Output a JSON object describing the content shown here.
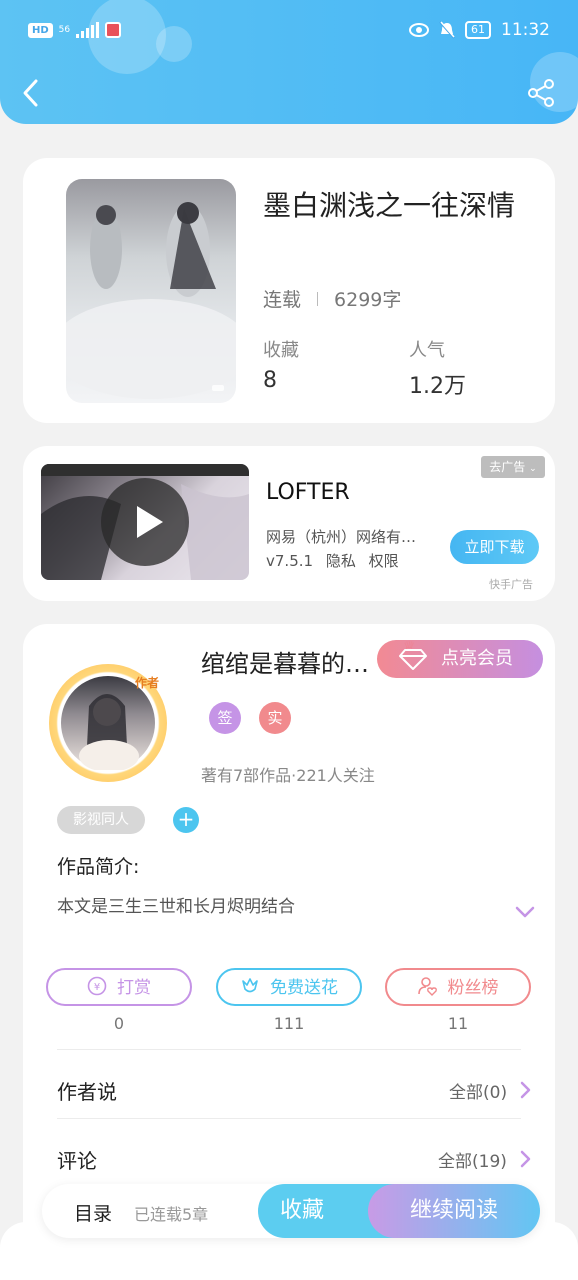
{
  "status": {
    "network": "HD",
    "signal": "56",
    "battery": "61",
    "time": "11:32"
  },
  "colors": {
    "brand": "#4db8f5",
    "vip": "#f28a93",
    "purple": "#c594e6",
    "pink": "#f18a8d",
    "teal": "#4cc5ef"
  },
  "book": {
    "title": "墨白渊浅之一往深情",
    "status": "连载",
    "word_count": "6299字",
    "collect_label": "收藏",
    "collect_value": "8",
    "popularity_label": "人气",
    "popularity_value": "1.2万"
  },
  "ad": {
    "title": "LOFTER",
    "company": "网易（杭州）网络有…",
    "version": "v7.5.1",
    "privacy": "隐私",
    "permission": "权限",
    "remove_ad": "去广告",
    "download": "立即下载",
    "source": "快手广告"
  },
  "author": {
    "badge": "作者",
    "name": "绾绾是暮暮的…",
    "vip_label": "点亮会员",
    "badge_signed": "签",
    "badge_real": "实",
    "stats": "著有7部作品·221人关注"
  },
  "tags": {
    "genre": "影视同人",
    "add": "+"
  },
  "intro": {
    "label": "作品简介:",
    "text": "本文是三生三世和长月烬明结合"
  },
  "actions": [
    {
      "label": "打赏",
      "count": "0",
      "color": "#c594e6"
    },
    {
      "label": "免费送花",
      "count": "111",
      "color": "#4cc5ef"
    },
    {
      "label": "粉丝榜",
      "count": "11",
      "color": "#f18a8d"
    }
  ],
  "author_says": {
    "label": "作者说",
    "all": "全部(0)"
  },
  "comments": {
    "label": "评论",
    "all": "全部(19)"
  },
  "bottom": {
    "toc": "目录",
    "chapters": "已连载5章",
    "collect": "收藏",
    "read": "继续阅读"
  }
}
